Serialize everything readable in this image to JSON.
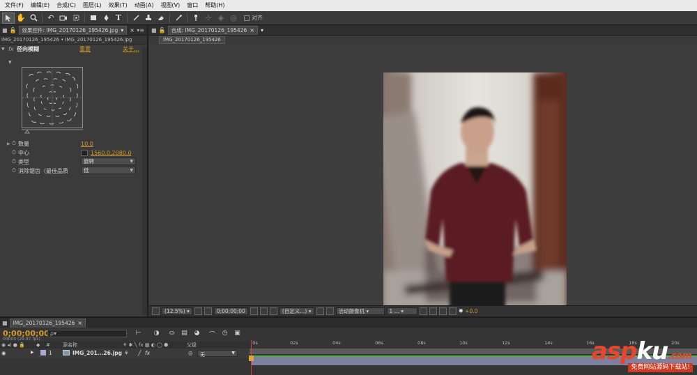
{
  "menubar": {
    "items": [
      "文件(F)",
      "编辑(E)",
      "合成(C)",
      "图层(L)",
      "效果(T)",
      "动画(A)",
      "视图(V)",
      "窗口",
      "帮助(H)"
    ]
  },
  "toolbar": {
    "tools": [
      "selection-tool",
      "hand-tool",
      "zoom-tool",
      "rotate-tool",
      "camera-tool",
      "pan-behind-tool",
      "rectangle-tool",
      "pen-tool",
      "text-tool",
      "brush-tool",
      "clone-stamp-tool",
      "eraser-tool",
      "roto-brush-tool",
      "puppet-pin-tool"
    ],
    "align_label": "对齐"
  },
  "effect_controls": {
    "tab_label": "效果控件: IMG_20170126_195426.jpg",
    "subtitle": "IMG_20170126_195426 • IMG_20170126_195426.jpg",
    "effect_name": "径向模糊",
    "reset_label": "重置",
    "about_label": "关于...",
    "fx_label": "fx",
    "props": [
      {
        "name": "数量",
        "value": "10.0"
      },
      {
        "name": "中心",
        "value": "1560.0,2080.0"
      },
      {
        "name": "类型",
        "value": "旋转"
      },
      {
        "name": "消除锯齿（最佳品质",
        "value": "低"
      }
    ]
  },
  "composition": {
    "tab_label": "合成: IMG_20170126_195426",
    "breadcrumb": "IMG_20170126_195426",
    "footer": {
      "zoom": "(12.5%)",
      "timecode": "0;00;00;00",
      "view_mode": "(自定义...)",
      "camera": "活动摄像机",
      "views": "1 ...",
      "exposure": "+0.0"
    }
  },
  "timeline": {
    "tab_label": "IMG_20170126_195426",
    "timecode": "0;00;00;00",
    "fps": "00000 (29.97 fps)",
    "search_placeholder": "ρ▾",
    "header": {
      "source_name": "源名称",
      "parent": "父级"
    },
    "layer": {
      "index": "1",
      "name": "IMG_201...26.jpg",
      "parent": "无"
    },
    "ruler": [
      "0s",
      "02s",
      "04s",
      "06s",
      "08s",
      "10s",
      "12s",
      "14s",
      "16s",
      "18s",
      "20s"
    ]
  },
  "watermark": {
    "logo_a": "asp",
    "logo_b": "ku",
    "logo_c": ".com",
    "tagline": "免费网站源码下载站!"
  }
}
